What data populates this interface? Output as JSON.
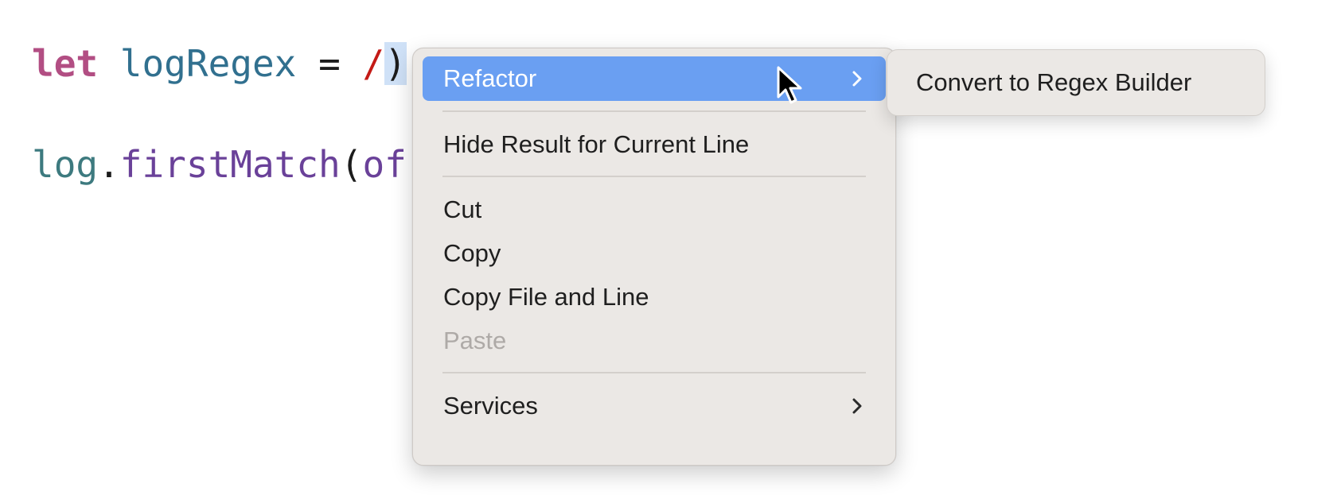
{
  "editor": {
    "line1": {
      "keyword": "let",
      "identifier": "logRegex",
      "operator": "=",
      "regex_start": "/",
      "selected_char": ")",
      "overflow": "(/"
    },
    "line2": {
      "object": "log",
      "dot": ".",
      "method": "firstMatch",
      "paren": "(",
      "arg": "of"
    }
  },
  "context_menu": {
    "items": [
      {
        "label": "Refactor",
        "has_submenu": true,
        "highlighted": true
      },
      {
        "label": "Hide Result for Current Line"
      },
      {
        "label": "Cut"
      },
      {
        "label": "Copy"
      },
      {
        "label": "Copy File and Line"
      },
      {
        "label": "Paste",
        "disabled": true
      },
      {
        "label": "Services",
        "has_submenu": true
      }
    ]
  },
  "submenu": {
    "items": [
      {
        "label": "Convert to Regex Builder"
      }
    ]
  },
  "icons": {
    "submenu_arrow": "chevron-right-icon",
    "pointer": "mouse-cursor-icon"
  },
  "colors": {
    "highlight": "#6a9ff2",
    "menu_bg": "#ebe8e5",
    "keyword": "#b24e83",
    "identifier": "#31708f",
    "method": "#6a4199",
    "regex": "#c41a16"
  }
}
